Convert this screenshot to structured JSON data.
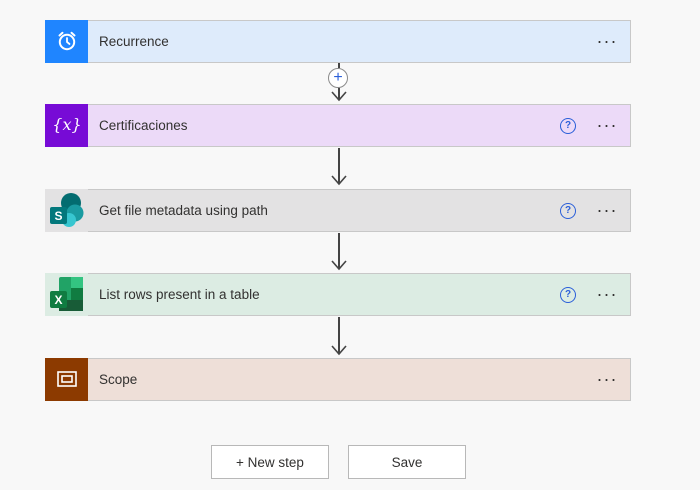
{
  "steps": [
    {
      "label": "Recurrence",
      "icon": "alarm-clock-icon",
      "header_bg": "#deebfb",
      "icon_bg": "#1f85ff",
      "has_help": false
    },
    {
      "label": "Certificaciones",
      "icon": "variable-icon",
      "header_bg": "#ecdaf8",
      "icon_bg": "#770bd6",
      "has_help": true
    },
    {
      "label": "Get file metadata using path",
      "icon": "sharepoint-icon",
      "header_bg": "#e3e2e3",
      "icon_bg": "#e3e2e3",
      "has_help": true
    },
    {
      "label": "List rows present in a table",
      "icon": "excel-icon",
      "header_bg": "#dcece3",
      "icon_bg": "#dcece3",
      "has_help": true
    },
    {
      "label": "Scope",
      "icon": "scope-icon",
      "header_bg": "#eedfd8",
      "icon_bg": "#8c3a00",
      "has_help": false
    }
  ],
  "help_glyph": "?",
  "more_glyph": "···",
  "insert_glyph": "+",
  "buttons": {
    "new_step": "+ New step",
    "save": "Save"
  }
}
